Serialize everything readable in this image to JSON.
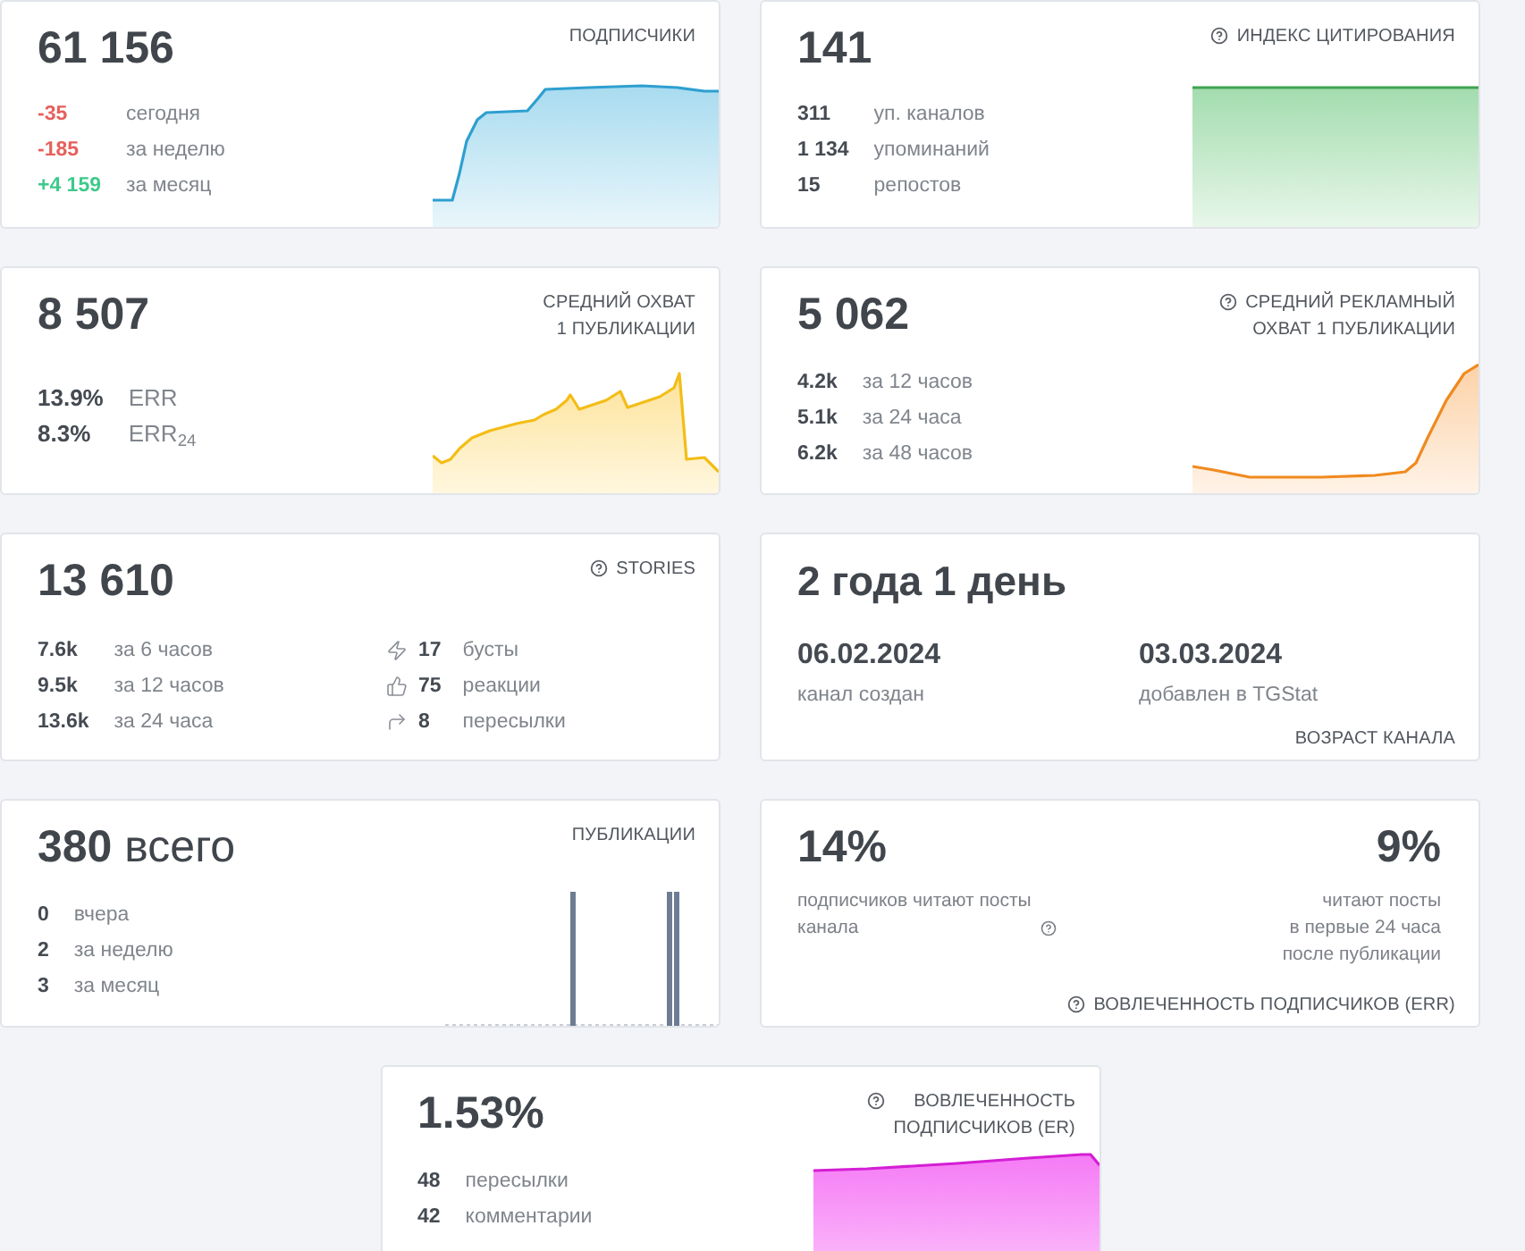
{
  "cards": [
    {
      "kind": "subscribers",
      "title": "ПОДПИСЧИКИ",
      "hint": false,
      "value": "61 156",
      "stats": [
        {
          "value": "-35",
          "label": "сегодня",
          "color": "#e5605c"
        },
        {
          "value": "-185",
          "label": "за неделю",
          "color": "#e5605c"
        },
        {
          "value": "+4 159",
          "label": "за месяц",
          "color": "#3ec98c"
        }
      ]
    },
    {
      "kind": "citation",
      "title": "ИНДЕКС ЦИТИРОВАНИЯ",
      "hint": true,
      "value": "141",
      "stats": [
        {
          "value": "311",
          "label": "уп. каналов"
        },
        {
          "value": "1 134",
          "label": "упоминаний"
        },
        {
          "value": "15",
          "label": "репостов"
        }
      ]
    },
    {
      "kind": "reach",
      "title": "СРЕДНИЙ ОХВАТ\n1 ПУБЛИКАЦИИ",
      "hint": false,
      "value": "8 507",
      "stats": [
        {
          "value": "13.9%",
          "label": "ERR"
        },
        {
          "value": "8.3%",
          "label": "ERR$_{24}$"
        }
      ]
    },
    {
      "kind": "ad_reach",
      "title": "СРЕДНИЙ РЕКЛАМНЫЙ\nОХВАТ 1 ПУБЛИКАЦИИ",
      "hint": true,
      "value": "5 062",
      "stats": [
        {
          "value": "4.2k",
          "label": "за 12 часов"
        },
        {
          "value": "5.1k",
          "label": "за 24 часа"
        },
        {
          "value": "6.2k",
          "label": "за 48 часов"
        }
      ]
    },
    {
      "kind": "stories",
      "title": "STORIES",
      "hint": true,
      "value": "13 610",
      "stats": [
        {
          "value": "7.6k",
          "label": "за 6 часов"
        },
        {
          "value": "9.5k",
          "label": "за 12 часов"
        },
        {
          "value": "13.6k",
          "label": "за 24 часа"
        }
      ],
      "interactions": [
        {
          "value": "17",
          "label": "бусты"
        },
        {
          "value": "75",
          "label": "реакции"
        },
        {
          "value": "8",
          "label": "пересылки"
        }
      ]
    },
    {
      "kind": "age",
      "title": "ВОЗРАСТ КАНАЛА",
      "hint": false,
      "value": "2 года 1 день",
      "dates": [
        {
          "date": "06.02.2024",
          "label": "канал создан"
        },
        {
          "date": "03.03.2024",
          "label": "добавлен в TGStat"
        }
      ]
    },
    {
      "kind": "publications",
      "title": "ПУБЛИКАЦИИ",
      "hint": false,
      "value": "**380** всего",
      "stats": [
        {
          "value": "0",
          "label": "вчера"
        },
        {
          "value": "2",
          "label": "за неделю"
        },
        {
          "value": "3",
          "label": "за месяц"
        }
      ]
    },
    {
      "kind": "err",
      "title": "ВОВЛЕЧЕННОСТЬ ПОДПИСЧИКОВ (ERR)",
      "hint": true,
      "parts": [
        {
          "value": "14%",
          "caption": "подписчиков читают посты\nканала",
          "hint": true
        },
        {
          "value": "9%",
          "caption": "читают посты\nв первые 24 часа\nпосле публикации",
          "hint": false
        }
      ]
    },
    {
      "kind": "er",
      "title": "ВОВЛЕЧЕННОСТЬ\nПОДПИСЧИКОВ (ER)",
      "hint": true,
      "value": "1.53%",
      "stats": [
        {
          "value": "48",
          "label": "пересылки"
        },
        {
          "value": "42",
          "label": "комментарии"
        }
      ]
    }
  ]
}
